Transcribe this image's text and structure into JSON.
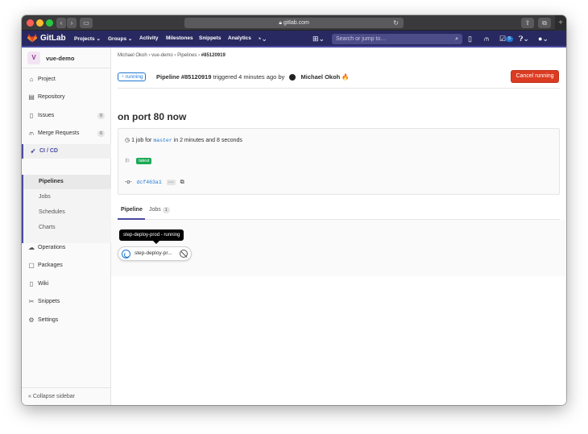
{
  "browser": {
    "address": "gitlab.com"
  },
  "navbar": {
    "brand": "GitLab",
    "items": [
      "Projects",
      "Groups",
      "Activity",
      "Milestones",
      "Snippets",
      "Analytics"
    ],
    "search_placeholder": "Search or jump to…",
    "todo_count": "5"
  },
  "sidebar": {
    "avatar_letter": "V",
    "project_name": "vue-demo",
    "items": [
      {
        "label": "Project",
        "icon": "house-icon"
      },
      {
        "label": "Repository",
        "icon": "book-icon"
      },
      {
        "label": "Issues",
        "icon": "issues-icon",
        "count": "0"
      },
      {
        "label": "Merge Requests",
        "icon": "merge-icon",
        "count": "0"
      },
      {
        "label": "CI / CD",
        "icon": "rocket-icon"
      }
    ],
    "cicd_sub": [
      "Pipelines",
      "Jobs",
      "Schedules",
      "Charts"
    ],
    "lower_items": [
      {
        "label": "Operations",
        "icon": "cloud-icon"
      },
      {
        "label": "Packages",
        "icon": "package-icon"
      },
      {
        "label": "Wiki",
        "icon": "wiki-icon"
      },
      {
        "label": "Snippets",
        "icon": "scissors-icon"
      },
      {
        "label": "Settings",
        "icon": "gear-icon"
      }
    ],
    "collapse_label": "Collapse sidebar"
  },
  "breadcrumb": {
    "items": [
      "Michael Okoh",
      "vue-demo",
      "Pipelines",
      "#85120919"
    ]
  },
  "pipeline": {
    "status": "running",
    "title_prefix": "Pipeline #85120919",
    "triggered": "triggered 4 minutes ago by",
    "user": "Michael Okoh",
    "user_emoji": "🔥",
    "cancel_label": "Cancel running",
    "commit_title": "on port 80 now",
    "jobs_summary_a": "1 job for",
    "branch": "master",
    "jobs_summary_b": "in 2 minutes and 8 seconds",
    "tag": "latest",
    "sha": "dcf463a1",
    "sha_more": "···"
  },
  "tabs": {
    "pipeline": "Pipeline",
    "jobs": "Jobs",
    "jobs_count": "1"
  },
  "graph": {
    "tooltip": "step-deploy-prod - running",
    "job_name": "step-deploy-pr..."
  }
}
